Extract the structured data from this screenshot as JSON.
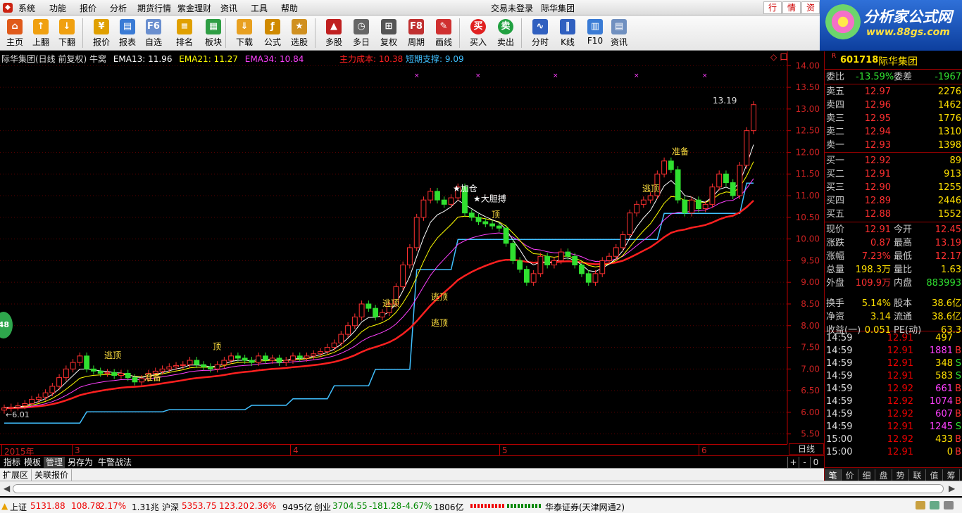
{
  "menubar": {
    "items": [
      "系统",
      "功能",
      "报价",
      "分析",
      "期货行情",
      "紫金理财",
      "资讯",
      "工具",
      "帮助"
    ],
    "login_status": "交易未登录",
    "stock_name": "际华集团",
    "win_buttons": [
      "行",
      "情",
      "资"
    ]
  },
  "toolbar": {
    "buttons": [
      {
        "label": "主页",
        "icon": "home-icon",
        "color": "#e05a1a"
      },
      {
        "label": "上翻",
        "icon": "arrow-up-icon",
        "color": "#f0a010"
      },
      {
        "label": "下翻",
        "icon": "arrow-down-icon",
        "color": "#f0a010"
      },
      {
        "label": "报价",
        "icon": "quote-icon",
        "color": "#e0a000"
      },
      {
        "label": "报表",
        "icon": "report-icon",
        "color": "#3a7bd5"
      },
      {
        "label": "自选",
        "icon": "f6-icon",
        "color": "#6a8fcf"
      },
      {
        "label": "排名",
        "icon": "rank-icon",
        "color": "#e0a000"
      },
      {
        "label": "板块",
        "icon": "sector-icon",
        "color": "#2f9e44"
      },
      {
        "label": "下载",
        "icon": "download-icon",
        "color": "#e8a020"
      },
      {
        "label": "公式",
        "icon": "formula-icon",
        "color": "#d08a00"
      },
      {
        "label": "选股",
        "icon": "pick-stock-icon",
        "color": "#d09020"
      },
      {
        "label": "多股",
        "icon": "multi-stock-icon",
        "color": "#c02020"
      },
      {
        "label": "多日",
        "icon": "clock-icon",
        "color": "#666666"
      },
      {
        "label": "复权",
        "icon": "restore-right-icon",
        "color": "#555555"
      },
      {
        "label": "周期",
        "icon": "f8-icon",
        "color": "#c03030"
      },
      {
        "label": "画线",
        "icon": "draw-line-icon",
        "color": "#d03030"
      },
      {
        "label": "买入",
        "icon": "buy-icon",
        "color": "#e02020"
      },
      {
        "label": "卖出",
        "icon": "sell-icon",
        "color": "#20a040"
      },
      {
        "label": "分时",
        "icon": "timeshare-icon",
        "color": "#3060c0"
      },
      {
        "label": "K线",
        "icon": "kline-icon",
        "color": "#3060c0"
      },
      {
        "label": "F10",
        "icon": "f10-icon",
        "color": "#3a7bd5"
      },
      {
        "label": "资讯",
        "icon": "news-icon",
        "color": "#7090c0"
      }
    ]
  },
  "logo": {
    "title": "分析家公式网",
    "url_text": "www.88gs.com"
  },
  "chart_header": {
    "title": "际华集团(日线 前复权) 牛窝",
    "ema13": "EMA13: 11.96",
    "ema21": "EMA21: 11.27",
    "ema34": "EMA34: 10.84",
    "main_cost": "主力成本: 10.38",
    "short_support": "短期支撑: 9.09",
    "colors": {
      "ema13": "#ffffff",
      "ema21": "#ffff00",
      "ema34": "#ff40ff",
      "main_cost": "#ff2020",
      "short_support": "#40c0ff"
    }
  },
  "chart_data": {
    "type": "candlestick",
    "ylim": [
      5.3,
      14.2
    ],
    "y_ticks": [
      "14.00",
      "13.50",
      "13.00",
      "12.50",
      "12.00",
      "11.50",
      "11.00",
      "10.50",
      "10.00",
      "9.50",
      "9.00",
      "8.50",
      "8.00",
      "7.50",
      "7.00",
      "6.50",
      "6.00",
      "5.50"
    ],
    "date_labels": [
      "2015年",
      "3",
      "4",
      "5",
      "6"
    ],
    "price_min_label": "6.01",
    "price_max_label": "13.19",
    "annotations": [
      "逃顶",
      "准备",
      "顶",
      "逃顶",
      "加仓",
      "大胆搏",
      "逃顶",
      "逃顶",
      "准备",
      "顶",
      "逃顶"
    ],
    "close": [
      6.1,
      6.12,
      6.15,
      6.2,
      6.3,
      6.35,
      6.45,
      6.6,
      6.8,
      7.0,
      7.15,
      7.3,
      7.0,
      6.95,
      6.9,
      6.92,
      6.85,
      6.9,
      6.8,
      6.7,
      6.78,
      6.9,
      6.95,
      7.0,
      7.05,
      7.08,
      7.1,
      7.2,
      7.1,
      7.05,
      7.0,
      7.1,
      7.2,
      7.3,
      7.25,
      7.2,
      7.15,
      7.3,
      7.2,
      7.25,
      7.15,
      7.2,
      7.3,
      7.25,
      7.3,
      7.35,
      7.4,
      7.5,
      7.6,
      7.8,
      8.0,
      8.2,
      8.5,
      8.4,
      8.2,
      8.3,
      8.5,
      8.9,
      9.4,
      9.8,
      10.5,
      10.9,
      11.1,
      10.9,
      10.8,
      10.95,
      11.2,
      10.6,
      10.5,
      10.4,
      10.35,
      10.3,
      10.25,
      9.9,
      9.5,
      9.3,
      9.0,
      9.2,
      9.6,
      9.4,
      9.5,
      9.7,
      9.6,
      9.4,
      9.2,
      9.0,
      9.2,
      9.5,
      9.6,
      9.8,
      10.1,
      10.6,
      10.8,
      10.9,
      11.0,
      11.5,
      11.8,
      11.6,
      10.9,
      10.6,
      10.9,
      10.7,
      10.8,
      11.2,
      11.5,
      11.3,
      11.0,
      11.7,
      12.5,
      13.1
    ]
  },
  "chart_legend_markers": [
    "◇",
    "口"
  ],
  "zoom_label": "日线",
  "tabs": {
    "items": [
      "指标",
      "模板",
      "管理",
      "另存为",
      "牛警战法"
    ],
    "active": 2,
    "ctrls": [
      "+",
      "-",
      "0"
    ]
  },
  "extbar": {
    "items": [
      "扩展区",
      "关联报价"
    ]
  },
  "quote_panel": {
    "code": "601718",
    "name": "际华集团",
    "r_mark": "R",
    "ratio_label": "委比",
    "ratio_value": "-13.59%",
    "diff_label": "委差",
    "diff_value": "-1967",
    "asks": [
      {
        "label": "卖五",
        "price": "12.97",
        "vol": "2276"
      },
      {
        "label": "卖四",
        "price": "12.96",
        "vol": "1462"
      },
      {
        "label": "卖三",
        "price": "12.95",
        "vol": "1776"
      },
      {
        "label": "卖二",
        "price": "12.94",
        "vol": "1310"
      },
      {
        "label": "卖一",
        "price": "12.93",
        "vol": "1398"
      }
    ],
    "bids": [
      {
        "label": "买一",
        "price": "12.92",
        "vol": "89"
      },
      {
        "label": "买二",
        "price": "12.91",
        "vol": "913"
      },
      {
        "label": "买三",
        "price": "12.90",
        "vol": "1255"
      },
      {
        "label": "买四",
        "price": "12.89",
        "vol": "2446"
      },
      {
        "label": "买五",
        "price": "12.88",
        "vol": "1552"
      }
    ],
    "stats": [
      {
        "l1": "现价",
        "v1": "12.91",
        "c1": "#ff3030",
        "l2": "今开",
        "v2": "12.45",
        "c2": "#ff3030"
      },
      {
        "l1": "涨跌",
        "v1": "0.87",
        "c1": "#ff3030",
        "l2": "最高",
        "v2": "13.19",
        "c2": "#ff3030"
      },
      {
        "l1": "涨幅",
        "v1": "7.23%",
        "c1": "#ff3030",
        "l2": "最低",
        "v2": "12.17",
        "c2": "#ff3030"
      },
      {
        "l1": "总量",
        "v1": "198.3万",
        "c1": "#ffe000",
        "l2": "量比",
        "v2": "1.63",
        "c2": "#ffe000"
      },
      {
        "l1": "外盘",
        "v1": "109.9万",
        "c1": "#ff3030",
        "l2": "内盘",
        "v2": "883993",
        "c2": "#30e030"
      },
      {
        "l1": "换手",
        "v1": "5.14%",
        "c1": "#ffe000",
        "l2": "股本",
        "v2": "38.6亿",
        "c2": "#ffe000"
      },
      {
        "l1": "净资",
        "v1": "3.14",
        "c1": "#ffe000",
        "l2": "流通",
        "v2": "38.6亿",
        "c2": "#ffe000"
      },
      {
        "l1": "收益(一)",
        "v1": "0.051",
        "c1": "#ffe000",
        "l2": "PE(动)",
        "v2": "63.3",
        "c2": "#ffe000"
      }
    ],
    "trades": [
      {
        "t": "14:59",
        "p": "12.91",
        "v": "497",
        "vc": "#ffe000",
        "bs": "",
        "bc": "#ff3030"
      },
      {
        "t": "14:59",
        "p": "12.91",
        "v": "1881",
        "vc": "#ff40ff",
        "bs": "B",
        "bc": "#ff3030"
      },
      {
        "t": "14:59",
        "p": "12.91",
        "v": "348",
        "vc": "#ffe000",
        "bs": "S",
        "bc": "#30e030"
      },
      {
        "t": "14:59",
        "p": "12.91",
        "v": "583",
        "vc": "#ffe000",
        "bs": "S",
        "bc": "#30e030"
      },
      {
        "t": "14:59",
        "p": "12.92",
        "v": "661",
        "vc": "#ff40ff",
        "bs": "B",
        "bc": "#ff3030"
      },
      {
        "t": "14:59",
        "p": "12.92",
        "v": "1074",
        "vc": "#ff40ff",
        "bs": "B",
        "bc": "#ff3030"
      },
      {
        "t": "14:59",
        "p": "12.92",
        "v": "607",
        "vc": "#ff40ff",
        "bs": "B",
        "bc": "#ff3030"
      },
      {
        "t": "14:59",
        "p": "12.91",
        "v": "1245",
        "vc": "#ff40ff",
        "bs": "S",
        "bc": "#30e030"
      },
      {
        "t": "15:00",
        "p": "12.92",
        "v": "433",
        "vc": "#ffe000",
        "bs": "B",
        "bc": "#ff3030"
      },
      {
        "t": "15:00",
        "p": "12.91",
        "v": "0",
        "vc": "#ffe000",
        "bs": "B",
        "bc": "#ff3030"
      }
    ],
    "bottom_tabs": [
      "笔",
      "价",
      "细",
      "盘",
      "势",
      "联",
      "值",
      "筹"
    ]
  },
  "side_badge": "48",
  "statusbar": {
    "sh_label": "上证",
    "sh_index": "5131.88",
    "sh_change": "108.78",
    "sh_pct": "2.17%",
    "sh_amount": "1.31兆",
    "hs_label": "沪深",
    "hs_index": "5353.75",
    "hs_change": "123.20",
    "hs_pct": "2.36%",
    "hs_amount": "9495亿",
    "cy_label": "创业",
    "cy_index": "3704.55",
    "cy_change": "-181.28",
    "cy_pct": "-4.67%",
    "cy_amount": "1806亿",
    "broker": "华泰证券(天津网通2)"
  }
}
